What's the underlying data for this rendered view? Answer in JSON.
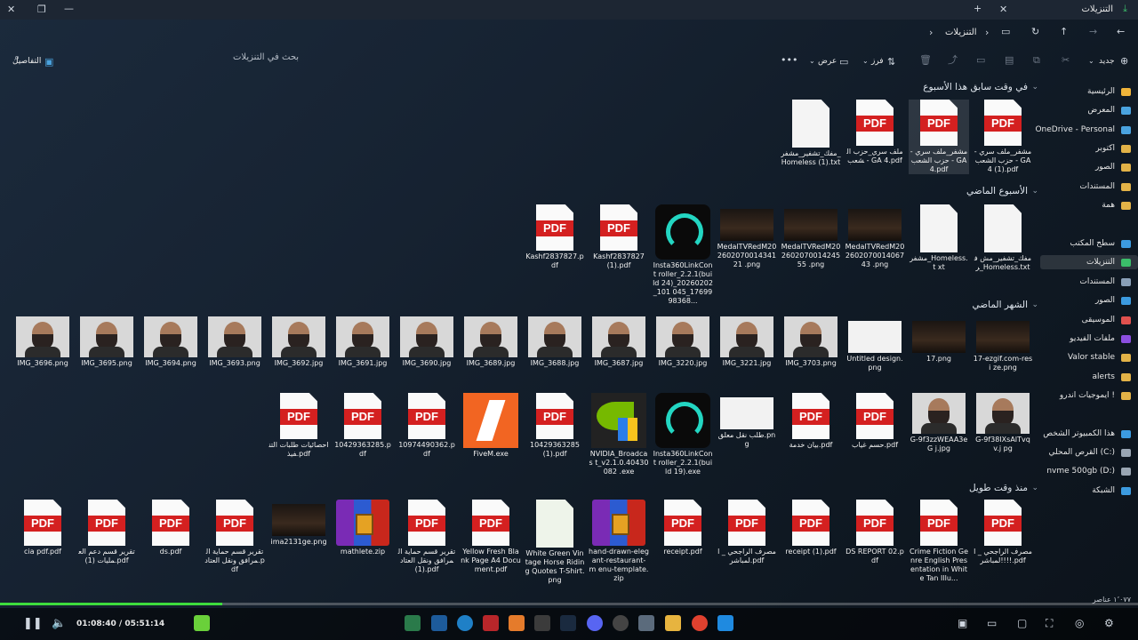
{
  "window": {
    "title": "التنزيلات"
  },
  "address": {
    "current": "التنزيلات",
    "search_placeholder": "بحث في التنزيلات"
  },
  "toolbar": {
    "new": "جديد",
    "sort": "فرز",
    "view": "عرض",
    "details": "التفاصيل"
  },
  "nav": {
    "items": [
      {
        "label": "الرئيسية",
        "color": "#f0b43a"
      },
      {
        "label": "المعرض",
        "color": "#4aa3df"
      },
      {
        "label": "OneDrive - Personal",
        "color": "#4aa3df"
      },
      {
        "label": "اكتوبر",
        "color": "#e2b247"
      },
      {
        "label": "الصور",
        "color": "#e2b247"
      },
      {
        "label": "المستندات",
        "color": "#e2b247"
      },
      {
        "label": "همة",
        "color": "#e2b247"
      },
      {
        "label": "سطح المكتب",
        "color": "#3c9be0"
      },
      {
        "label": "التنزيلات",
        "color": "#3bbd6a"
      },
      {
        "label": "المستندات",
        "color": "#8aa0b8"
      },
      {
        "label": "الصور",
        "color": "#3c9be0"
      },
      {
        "label": "الموسيقى",
        "color": "#e0514e"
      },
      {
        "label": "ملفات الفيديو",
        "color": "#8c4fe0"
      },
      {
        "label": "Valor stable",
        "color": "#e2b247"
      },
      {
        "label": "alerts",
        "color": "#e2b247"
      },
      {
        "label": "ايموجيات اندرو !",
        "color": "#e2b247"
      },
      {
        "label": "هذا الكمبيوتر الشخص",
        "color": "#3c9be0"
      },
      {
        "label": "القرص المحلي (C:)",
        "color": "#9aa6b3"
      },
      {
        "label": "nvme 500gb (D:)",
        "color": "#9aa6b3"
      },
      {
        "label": "الشبكة",
        "color": "#3c9be0"
      }
    ]
  },
  "groups": [
    {
      "label": "في وقت سابق هذا الأسبوع"
    },
    {
      "label": "الأسبوع الماضي"
    },
    {
      "label": "الشهر الماضي"
    },
    {
      "label": "منذ وقت طويل"
    }
  ],
  "files": {
    "row1": [
      {
        "kind": "pdf",
        "name": "مشفر_ملف سري - حزب الشعب - GA 4 (1).pdf"
      },
      {
        "kind": "pdf",
        "name": "مشفر_ملف سري - حزب الشعب - GA 4.pdf"
      },
      {
        "kind": "pdf",
        "name": "ملف سري_حزب الشعب - GA 4.pdf"
      },
      {
        "kind": "txt",
        "name": "مفك_تشفير_مشفر_Homeless (1).txt"
      }
    ],
    "row2": [
      {
        "kind": "txt",
        "name": "مفك_تشفير_مش فر_Homeless.txt"
      },
      {
        "kind": "txt",
        "name": "مشفر_Homeless.t xt"
      },
      {
        "kind": "dark",
        "name": "MedalTVRedM20 260207001406743 .png"
      },
      {
        "kind": "dark",
        "name": "MedalTVRedM20 260207001424555 .png"
      },
      {
        "kind": "dark",
        "name": "MedalTVRedM20 260207001434121 .png"
      },
      {
        "kind": "insta",
        "name": "Insta360LinkCont roller_2.2.1(build 24)_20260202_101 045_1769998368..."
      },
      {
        "kind": "pdf",
        "name": "Kashf2837827 (1).pdf"
      },
      {
        "kind": "pdf",
        "name": "Kashf2837827.pdf"
      }
    ],
    "row3": [
      {
        "kind": "dark",
        "name": "17-ezgif.com-resi ze.png"
      },
      {
        "kind": "dark",
        "name": "17.png"
      },
      {
        "kind": "blank",
        "name": "Untitled design.png"
      },
      {
        "kind": "photo",
        "name": "IMG_3703.png"
      },
      {
        "kind": "photo",
        "name": "IMG_3221.jpg"
      },
      {
        "kind": "photo",
        "name": "IMG_3220.jpg"
      },
      {
        "kind": "photo",
        "name": "IMG_3687.jpg"
      },
      {
        "kind": "photo",
        "name": "IMG_3688.jpg"
      },
      {
        "kind": "photo",
        "name": "IMG_3689.jpg"
      },
      {
        "kind": "photo",
        "name": "IMG_3690.jpg"
      },
      {
        "kind": "photo",
        "name": "IMG_3691.jpg"
      },
      {
        "kind": "photo",
        "name": "IMG_3692.jpg"
      },
      {
        "kind": "photo",
        "name": "IMG_3693.png"
      },
      {
        "kind": "photo",
        "name": "IMG_3694.png"
      },
      {
        "kind": "photo",
        "name": "IMG_3695.png"
      },
      {
        "kind": "photo",
        "name": "IMG_3696.png"
      }
    ],
    "row4": [
      {
        "kind": "photo",
        "name": "G-9f38IXsAITvqv.j pg"
      },
      {
        "kind": "photo",
        "name": "G-9f3zzWEAA3eG j.jpg"
      },
      {
        "kind": "pdf",
        "name": "حسم غياب.pdf"
      },
      {
        "kind": "pdf",
        "name": "بيان خدمة.pdf"
      },
      {
        "kind": "blank",
        "name": "طلب نقل معلق.png"
      },
      {
        "kind": "insta",
        "name": "Insta360LinkCont roller_2.2.1(build 19).exe"
      },
      {
        "kind": "nvidia",
        "name": "NVIDIA_Broadcas t_v2.1.0.40430082 .exe"
      },
      {
        "kind": "pdf",
        "name": "10429363285 (1).pdf"
      },
      {
        "kind": "fivem",
        "name": "FiveM.exe"
      },
      {
        "kind": "pdf",
        "name": "10974490362.pdf"
      },
      {
        "kind": "pdf",
        "name": "10429363285.pdf"
      },
      {
        "kind": "pdf",
        "name": "احصائيات طلبات التنفيذ.pdf"
      }
    ],
    "row5": [
      {
        "kind": "pdf",
        "name": "مصرف الراجحي _ المباشر!!!!.pdf"
      },
      {
        "kind": "pdf",
        "name": "Crime Fiction Genre English Presentation in White Tan Illu..."
      },
      {
        "kind": "pdf",
        "name": "DS REPORT 02.pdf"
      },
      {
        "kind": "pdf",
        "name": "receipt (1).pdf"
      },
      {
        "kind": "pdf",
        "name": "مصرف الراجحي _ المباشر.pdf"
      },
      {
        "kind": "pdf",
        "name": "receipt.pdf"
      },
      {
        "kind": "zip",
        "name": "hand-drawn-eleg ant-restaurant-m enu-template.zip"
      },
      {
        "kind": "doc",
        "name": "White Green Vintage Horse Riding Quotes T-Shirt.png"
      },
      {
        "kind": "pdf",
        "name": "Yellow Fresh Blank Page A4 Document.pdf"
      },
      {
        "kind": "pdf",
        "name": "تقرير قسم حماية المرافق ونقل العتاد (1).pdf"
      },
      {
        "kind": "zip",
        "name": "mathlete.zip"
      },
      {
        "kind": "dark",
        "name": "ima2131ge.png"
      },
      {
        "kind": "pdf",
        "name": "تقرير قسم حماية المرافق ونقل العتاد.pdf"
      },
      {
        "kind": "pdf",
        "name": "ds.pdf"
      },
      {
        "kind": "pdf",
        "name": "تقرير قسم دعم العمليات (1).pdf"
      },
      {
        "kind": "pdf",
        "name": "cia pdf.pdf"
      }
    ]
  },
  "status": {
    "count": "١٬٠٧٧ عناصر"
  },
  "player": {
    "time": "01:08:40 / 05:51:14",
    "progress_fraction": 0.195
  }
}
